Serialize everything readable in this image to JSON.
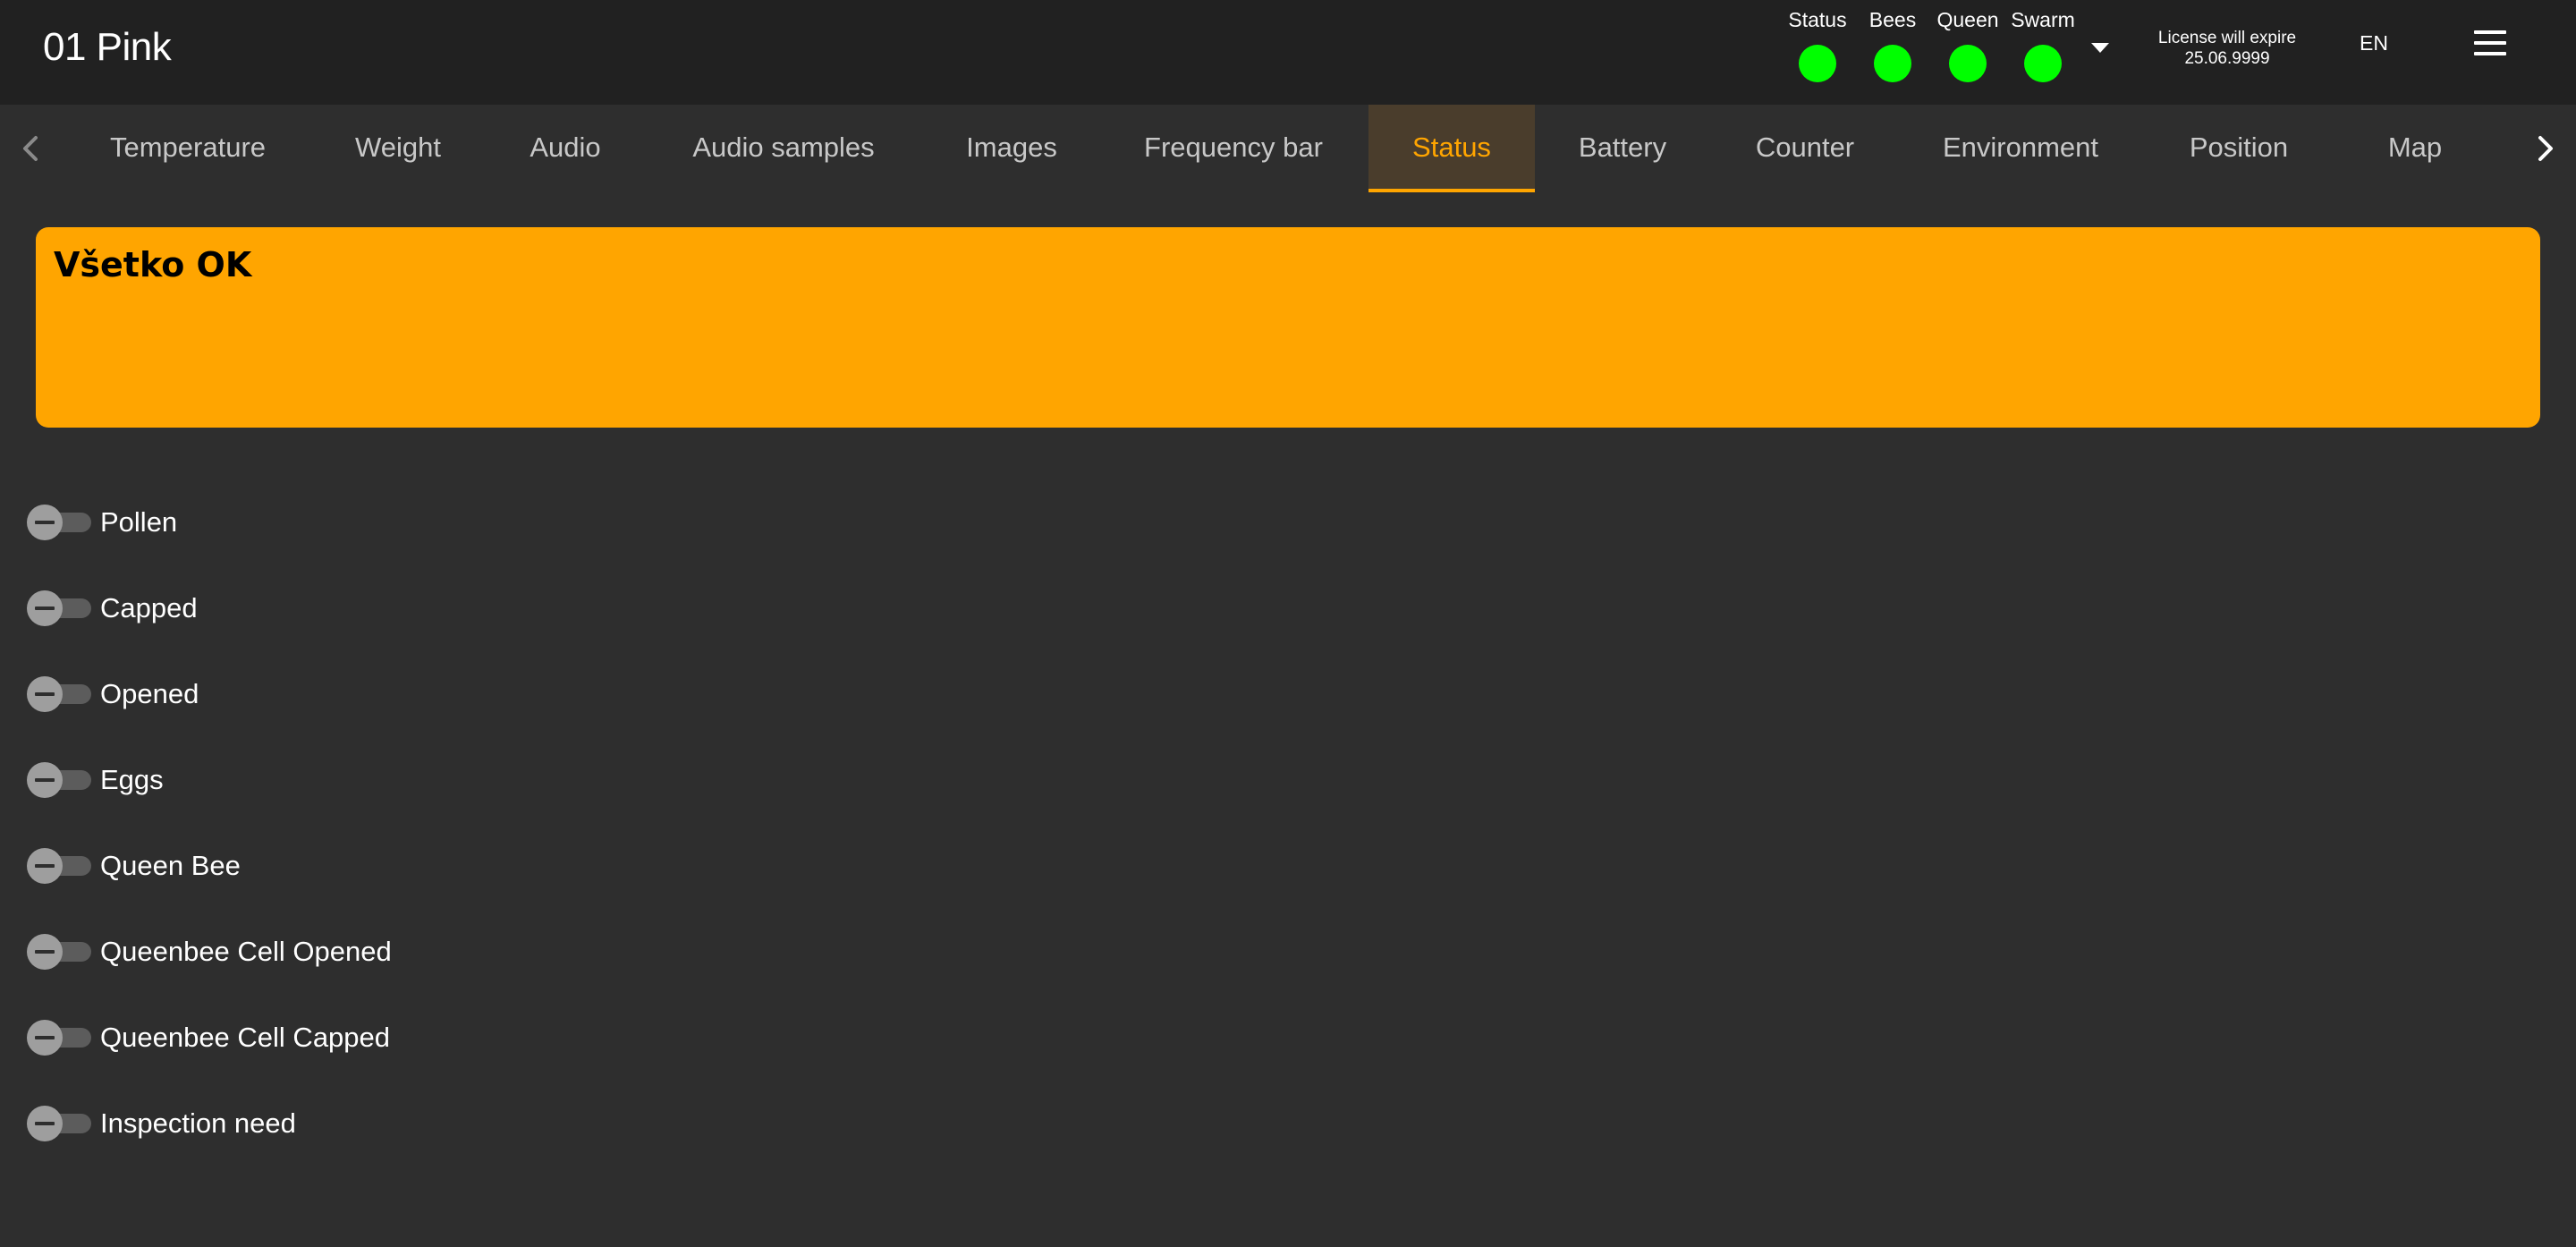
{
  "header": {
    "title": "01 Pink",
    "indicators": [
      {
        "label": "Status",
        "color": "#00ff00"
      },
      {
        "label": "Bees",
        "color": "#00ff00"
      },
      {
        "label": "Queen",
        "color": "#00ff00"
      },
      {
        "label": "Swarm",
        "color": "#00ff00"
      }
    ],
    "license_line1": "License will expire",
    "license_line2": "25.06.9999",
    "language": "EN"
  },
  "tabs": [
    {
      "label": "Temperature",
      "active": false
    },
    {
      "label": "Weight",
      "active": false
    },
    {
      "label": "Audio",
      "active": false
    },
    {
      "label": "Audio samples",
      "active": false
    },
    {
      "label": "Images",
      "active": false
    },
    {
      "label": "Frequency bar",
      "active": false
    },
    {
      "label": "Status",
      "active": true
    },
    {
      "label": "Battery",
      "active": false
    },
    {
      "label": "Counter",
      "active": false
    },
    {
      "label": "Environment",
      "active": false
    },
    {
      "label": "Position",
      "active": false
    },
    {
      "label": "Map",
      "active": false
    }
  ],
  "banner": {
    "text": "Všetko OK",
    "color": "#ffa500"
  },
  "toggles": [
    {
      "label": "Pollen",
      "state": "indeterminate"
    },
    {
      "label": "Capped",
      "state": "indeterminate"
    },
    {
      "label": "Opened",
      "state": "indeterminate"
    },
    {
      "label": "Eggs",
      "state": "indeterminate"
    },
    {
      "label": "Queen Bee",
      "state": "indeterminate"
    },
    {
      "label": "Queenbee Cell Opened",
      "state": "indeterminate"
    },
    {
      "label": "Queenbee Cell Capped",
      "state": "indeterminate"
    },
    {
      "label": "Inspection need",
      "state": "indeterminate"
    }
  ],
  "colors": {
    "accent": "#ffa500",
    "status_ok": "#00ff00",
    "header_bg": "#212121",
    "page_bg": "#2e2e2e"
  }
}
